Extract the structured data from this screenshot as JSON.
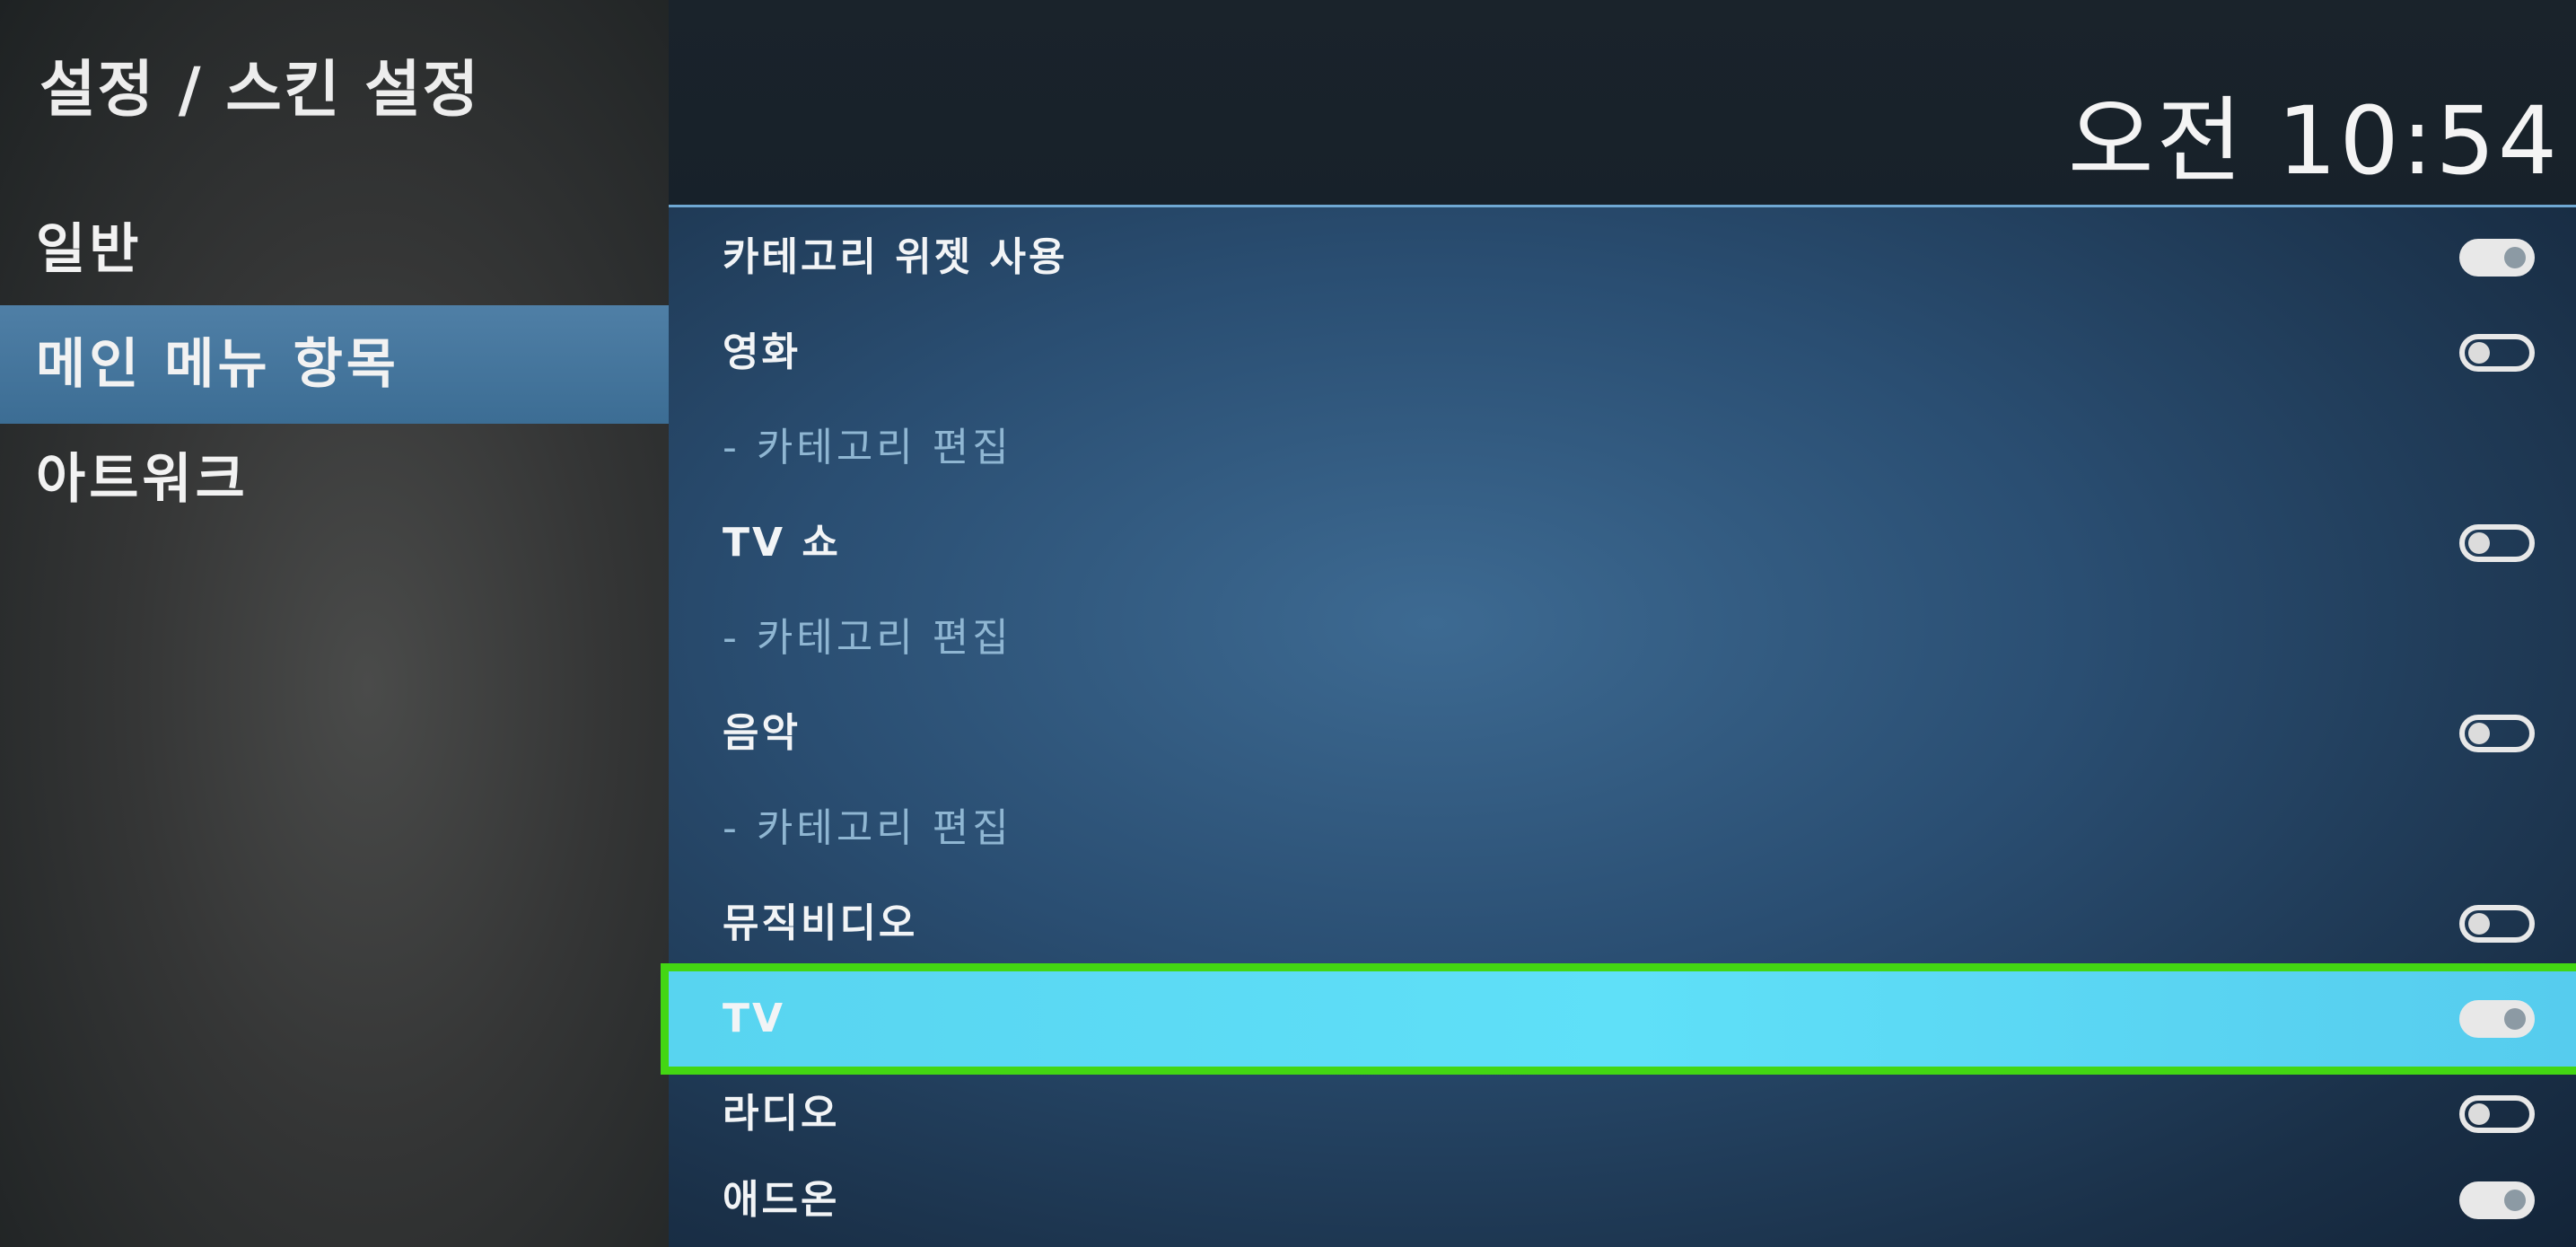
{
  "header": {
    "breadcrumb": "설정 / 스킨 설정",
    "clock": "오전 10:54"
  },
  "sidebar": {
    "items": [
      {
        "label": "일반",
        "selected": false
      },
      {
        "label": "메인 메뉴 항목",
        "selected": true
      },
      {
        "label": "아트워크",
        "selected": false
      }
    ]
  },
  "settings": {
    "rows": [
      {
        "label": "카테고리 위젯 사용",
        "type": "toggle",
        "on": true
      },
      {
        "label": "영화",
        "type": "toggle",
        "on": false
      },
      {
        "label": "- 카테고리 편집",
        "type": "sub"
      },
      {
        "label": "TV 쇼",
        "type": "toggle",
        "on": false
      },
      {
        "label": "- 카테고리 편집",
        "type": "sub"
      },
      {
        "label": "음악",
        "type": "toggle",
        "on": false
      },
      {
        "label": "- 카테고리 편집",
        "type": "sub"
      },
      {
        "label": "뮤직비디오",
        "type": "toggle",
        "on": false
      },
      {
        "label": "TV",
        "type": "toggle",
        "on": true,
        "focused": true
      },
      {
        "label": "라디오",
        "type": "toggle",
        "on": false
      },
      {
        "label": "애드온",
        "type": "toggle",
        "on": true
      }
    ]
  },
  "colors": {
    "focus_outline": "#43d613",
    "focus_row": "#5fe0f8",
    "sidebar_selected": "#4a7aa2"
  }
}
